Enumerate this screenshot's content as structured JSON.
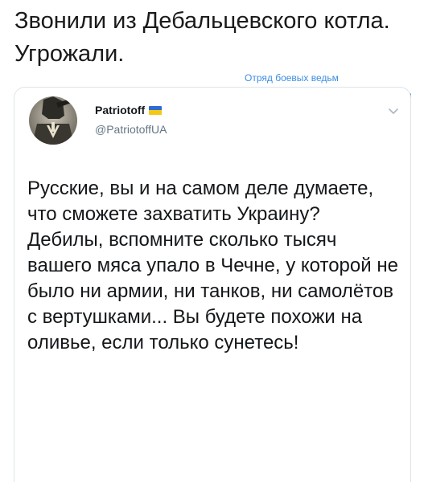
{
  "post": {
    "headline": "Звонили из Дебальцевского котла. Угрожали.",
    "watermark": "Отряд боевых ведьм"
  },
  "tweet": {
    "display_name": "Patriotoff",
    "handle": "@PatriotoffUA",
    "avatar_icon": "soldier-with-trident-avatar-icon",
    "caret_icon": "chevron-down-icon",
    "flag_icon": "ukraine-flag-icon",
    "flag_colors": {
      "top": "#2f6bd0",
      "bottom": "#f3c918"
    },
    "text": "Русские, вы и на самом деле думаете, что сможете захватить Украину?\nДебилы, вспомните сколько тысяч вашего мяса упало в Чечне, у которой не было ни армии, ни танков, ни самолётов с вертушками... Вы будете похожи на оливье, если только сунетесь!"
  },
  "colors": {
    "accent": "#3c8de3",
    "text": "#14171a",
    "muted": "#657786",
    "border": "#dfe4e8"
  }
}
